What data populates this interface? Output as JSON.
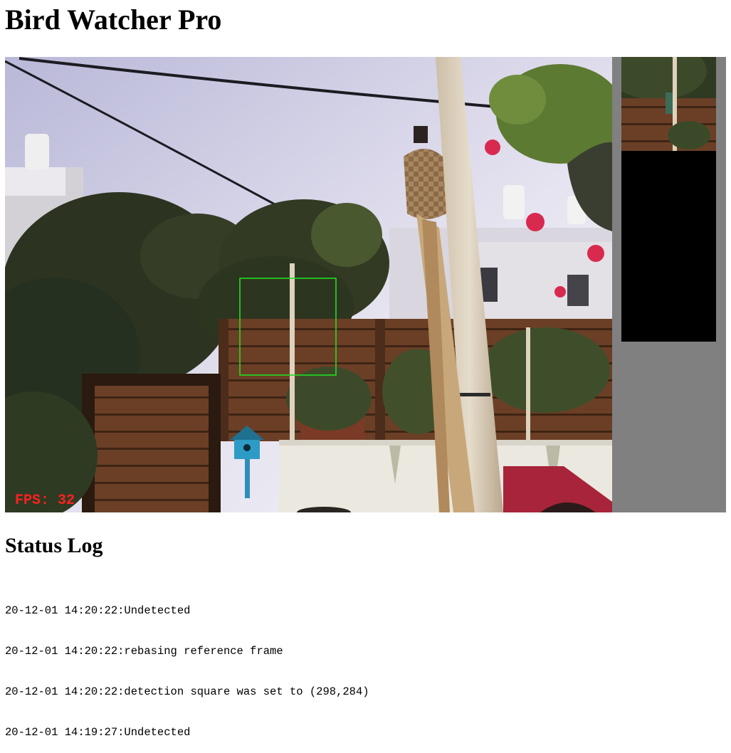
{
  "app": {
    "title": "Bird Watcher Pro"
  },
  "camera": {
    "fps_label": "FPS: 32",
    "fps_color": "#ff2020",
    "detection_box_color": "#22dd22"
  },
  "status_log": {
    "title": "Status Log",
    "entries": [
      "20-12-01 14:20:22:Undetected",
      "20-12-01 14:20:22:rebasing reference frame",
      "20-12-01 14:20:22:detection square was set to (298,284)",
      "20-12-01 14:19:27:Undetected"
    ]
  }
}
